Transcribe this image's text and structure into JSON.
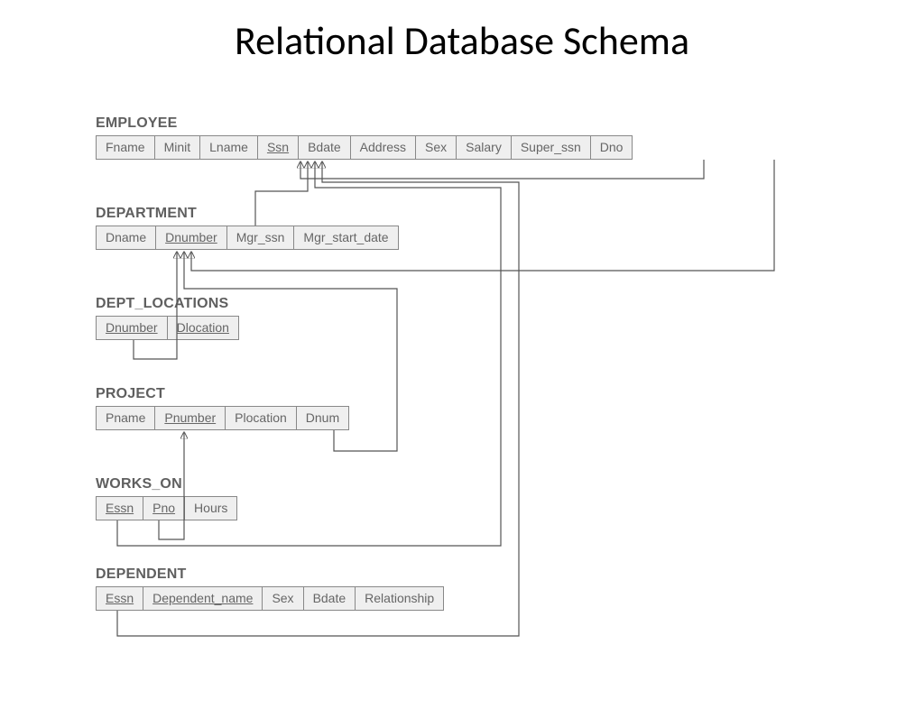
{
  "title": "Relational Database Schema",
  "tables": {
    "employee": {
      "name": "EMPLOYEE",
      "cols": [
        "Fname",
        "Minit",
        "Lname",
        "Ssn",
        "Bdate",
        "Address",
        "Sex",
        "Salary",
        "Super_ssn",
        "Dno"
      ],
      "pk": [
        false,
        false,
        false,
        true,
        false,
        false,
        false,
        false,
        false,
        false
      ]
    },
    "department": {
      "name": "DEPARTMENT",
      "cols": [
        "Dname",
        "Dnumber",
        "Mgr_ssn",
        "Mgr_start_date"
      ],
      "pk": [
        false,
        true,
        false,
        false
      ]
    },
    "dept_locations": {
      "name": "DEPT_LOCATIONS",
      "cols": [
        "Dnumber",
        "Dlocation"
      ],
      "pk": [
        true,
        true
      ]
    },
    "project": {
      "name": "PROJECT",
      "cols": [
        "Pname",
        "Pnumber",
        "Plocation",
        "Dnum"
      ],
      "pk": [
        false,
        true,
        false,
        false
      ]
    },
    "works_on": {
      "name": "WORKS_ON",
      "cols": [
        "Essn",
        "Pno",
        "Hours"
      ],
      "pk": [
        true,
        true,
        false
      ]
    },
    "dependent": {
      "name": "DEPENDENT",
      "cols": [
        "Essn",
        "Dependent_name",
        "Sex",
        "Bdate",
        "Relationship"
      ],
      "pk": [
        true,
        true,
        false,
        false,
        false
      ]
    }
  },
  "foreign_keys": [
    {
      "from": "EMPLOYEE.Super_ssn",
      "to": "EMPLOYEE.Ssn"
    },
    {
      "from": "EMPLOYEE.Dno",
      "to": "DEPARTMENT.Dnumber"
    },
    {
      "from": "DEPARTMENT.Mgr_ssn",
      "to": "EMPLOYEE.Ssn"
    },
    {
      "from": "DEPT_LOCATIONS.Dnumber",
      "to": "DEPARTMENT.Dnumber"
    },
    {
      "from": "PROJECT.Dnum",
      "to": "DEPARTMENT.Dnumber"
    },
    {
      "from": "WORKS_ON.Essn",
      "to": "EMPLOYEE.Ssn"
    },
    {
      "from": "WORKS_ON.Pno",
      "to": "PROJECT.Pnumber"
    },
    {
      "from": "DEPENDENT.Essn",
      "to": "EMPLOYEE.Ssn"
    }
  ]
}
